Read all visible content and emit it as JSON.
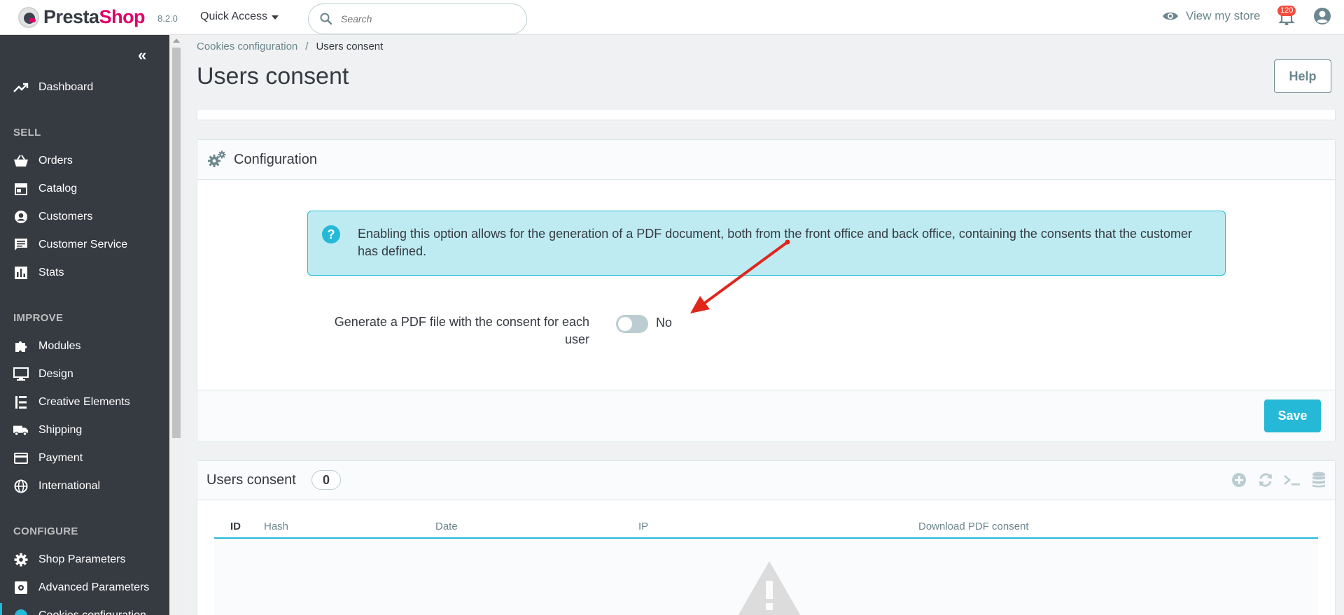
{
  "header": {
    "logo_presta": "Presta",
    "logo_shop": "Shop",
    "version": "8.2.0",
    "quick_access": "Quick Access",
    "search_placeholder": "Search",
    "view_store": "View my store",
    "notifications_count": "120"
  },
  "sidebar": {
    "dashboard": "Dashboard",
    "sections": {
      "sell": "SELL",
      "improve": "IMPROVE",
      "configure": "CONFIGURE"
    },
    "sell_items": [
      "Orders",
      "Catalog",
      "Customers",
      "Customer Service",
      "Stats"
    ],
    "improve_items": [
      "Modules",
      "Design",
      "Creative Elements",
      "Shipping",
      "Payment",
      "International"
    ],
    "configure_items": [
      "Shop Parameters",
      "Advanced Parameters",
      "Cookies configuration"
    ]
  },
  "breadcrumb": {
    "parent": "Cookies configuration",
    "separator": "/",
    "current": "Users consent"
  },
  "page": {
    "title": "Users consent",
    "help": "Help"
  },
  "config_panel": {
    "title": "Configuration",
    "alert_text": "Enabling this option allows for the generation of a PDF document, both from the front office and back office, containing the consents that the customer has defined.",
    "field_label": "Generate a PDF file with the consent for each user",
    "switch_value": "No",
    "switch_on": false,
    "save": "Save"
  },
  "list_panel": {
    "title": "Users consent",
    "count": "0",
    "columns": [
      "ID",
      "Hash",
      "Date",
      "IP",
      "Download PDF consent"
    ]
  },
  "colors": {
    "sidebar_bg": "#363a41",
    "accent": "#25b9d7",
    "brand_pink": "#df0067",
    "alert_bg": "#bdebf1",
    "annotation_arrow": "#e1261c"
  }
}
